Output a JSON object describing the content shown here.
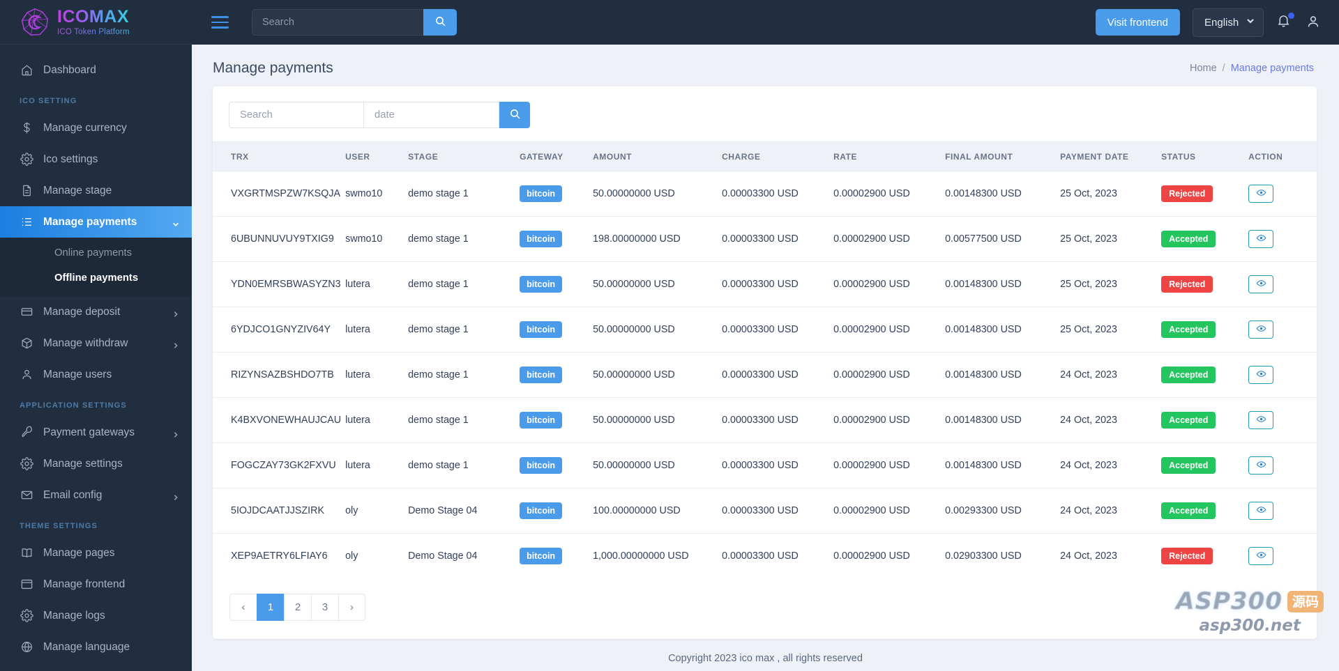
{
  "brand": {
    "title": "ICOMAX",
    "subtitle": "ICO Token Platform"
  },
  "topbar": {
    "search_placeholder": "Search",
    "visit_frontend": "Visit frontend",
    "language": "English"
  },
  "sidebar": {
    "items": [
      {
        "label": "Dashboard",
        "icon": "home-icon",
        "type": "item"
      },
      {
        "label": "ICO SETTING",
        "type": "caption"
      },
      {
        "label": "Manage currency",
        "icon": "dollar-icon",
        "type": "item"
      },
      {
        "label": "Ico settings",
        "icon": "gear-icon",
        "type": "item"
      },
      {
        "label": "Manage stage",
        "icon": "document-icon",
        "type": "item"
      },
      {
        "label": "Manage payments",
        "icon": "list-icon",
        "type": "item",
        "active": true,
        "caret": true
      },
      {
        "label": "Online payments",
        "type": "sub"
      },
      {
        "label": "Offline payments",
        "type": "sub",
        "active": true
      },
      {
        "label": "Manage deposit",
        "icon": "card-icon",
        "type": "item",
        "caret": true
      },
      {
        "label": "Manage withdraw",
        "icon": "box-icon",
        "type": "item",
        "caret": true
      },
      {
        "label": "Manage users",
        "icon": "user-icon",
        "type": "item"
      },
      {
        "label": "APPLICATION SETTINGS",
        "type": "caption"
      },
      {
        "label": "Payment gateways",
        "icon": "wrench-icon",
        "type": "item",
        "caret": true
      },
      {
        "label": "Manage settings",
        "icon": "gear-icon",
        "type": "item"
      },
      {
        "label": "Email config",
        "icon": "mail-icon",
        "type": "item",
        "caret": true
      },
      {
        "label": "THEME SETTINGS",
        "type": "caption"
      },
      {
        "label": "Manage pages",
        "icon": "book-icon",
        "type": "item"
      },
      {
        "label": "Manage frontend",
        "icon": "window-icon",
        "type": "item"
      },
      {
        "label": "Manage logs",
        "icon": "gear-icon",
        "type": "item"
      },
      {
        "label": "Manage language",
        "icon": "globe-icon",
        "type": "item"
      }
    ]
  },
  "page": {
    "title": "Manage payments",
    "breadcrumb": {
      "home": "Home",
      "separator": "/",
      "current": "Manage payments"
    }
  },
  "filters": {
    "search_placeholder": "Search",
    "date_placeholder": "date"
  },
  "table": {
    "columns": [
      "TRX",
      "USER",
      "STAGE",
      "GATEWAY",
      "AMOUNT",
      "CHARGE",
      "RATE",
      "FINAL AMOUNT",
      "PAYMENT DATE",
      "STATUS",
      "ACTION"
    ],
    "rows": [
      {
        "trx": "VXGRTMSPZW7KSQJA",
        "user": "swmo10",
        "stage": "demo stage 1",
        "gateway": "bitcoin",
        "amount": "50.00000000 USD",
        "charge": "0.00003300 USD",
        "rate": "0.00002900 USD",
        "final_amount": "0.00148300 USD",
        "payment_date": "25 Oct, 2023",
        "status": "Rejected"
      },
      {
        "trx": "6UBUNNUVUY9TXIG9",
        "user": "swmo10",
        "stage": "demo stage 1",
        "gateway": "bitcoin",
        "amount": "198.00000000 USD",
        "charge": "0.00003300 USD",
        "rate": "0.00002900 USD",
        "final_amount": "0.00577500 USD",
        "payment_date": "25 Oct, 2023",
        "status": "Accepted"
      },
      {
        "trx": "YDN0EMRSBWASYZN3",
        "user": "lutera",
        "stage": "demo stage 1",
        "gateway": "bitcoin",
        "amount": "50.00000000 USD",
        "charge": "0.00003300 USD",
        "rate": "0.00002900 USD",
        "final_amount": "0.00148300 USD",
        "payment_date": "25 Oct, 2023",
        "status": "Rejected"
      },
      {
        "trx": "6YDJCO1GNYZIV64Y",
        "user": "lutera",
        "stage": "demo stage 1",
        "gateway": "bitcoin",
        "amount": "50.00000000 USD",
        "charge": "0.00003300 USD",
        "rate": "0.00002900 USD",
        "final_amount": "0.00148300 USD",
        "payment_date": "25 Oct, 2023",
        "status": "Accepted"
      },
      {
        "trx": "RIZYNSAZBSHDO7TB",
        "user": "lutera",
        "stage": "demo stage 1",
        "gateway": "bitcoin",
        "amount": "50.00000000 USD",
        "charge": "0.00003300 USD",
        "rate": "0.00002900 USD",
        "final_amount": "0.00148300 USD",
        "payment_date": "24 Oct, 2023",
        "status": "Accepted"
      },
      {
        "trx": "K4BXVONEWHAUJCAU",
        "user": "lutera",
        "stage": "demo stage 1",
        "gateway": "bitcoin",
        "amount": "50.00000000 USD",
        "charge": "0.00003300 USD",
        "rate": "0.00002900 USD",
        "final_amount": "0.00148300 USD",
        "payment_date": "24 Oct, 2023",
        "status": "Accepted"
      },
      {
        "trx": "FOGCZAY73GK2FXVU",
        "user": "lutera",
        "stage": "demo stage 1",
        "gateway": "bitcoin",
        "amount": "50.00000000 USD",
        "charge": "0.00003300 USD",
        "rate": "0.00002900 USD",
        "final_amount": "0.00148300 USD",
        "payment_date": "24 Oct, 2023",
        "status": "Accepted"
      },
      {
        "trx": "5IOJDCAATJJSZIRK",
        "user": "oly",
        "stage": "Demo Stage 04",
        "gateway": "bitcoin",
        "amount": "100.00000000 USD",
        "charge": "0.00003300 USD",
        "rate": "0.00002900 USD",
        "final_amount": "0.00293300 USD",
        "payment_date": "24 Oct, 2023",
        "status": "Accepted"
      },
      {
        "trx": "XEP9AETRY6LFIAY6",
        "user": "oly",
        "stage": "Demo Stage 04",
        "gateway": "bitcoin",
        "amount": "1,000.00000000 USD",
        "charge": "0.00003300 USD",
        "rate": "0.00002900 USD",
        "final_amount": "0.02903300 USD",
        "payment_date": "24 Oct, 2023",
        "status": "Rejected"
      }
    ]
  },
  "pagination": {
    "pages": [
      "‹",
      "1",
      "2",
      "3",
      "›"
    ],
    "active": "1"
  },
  "footer": {
    "text": "Copyright 2023 ico max , all rights reserved"
  },
  "watermark": {
    "main": "ASP300",
    "badge": "源码",
    "sub": "asp300.net"
  },
  "colors": {
    "accent_blue": "#4a9bea",
    "sidebar_bg": "#212e40",
    "status_accepted": "#22c55e",
    "status_rejected": "#ef4444",
    "breadcrumb_current": "#6c7ae0"
  }
}
